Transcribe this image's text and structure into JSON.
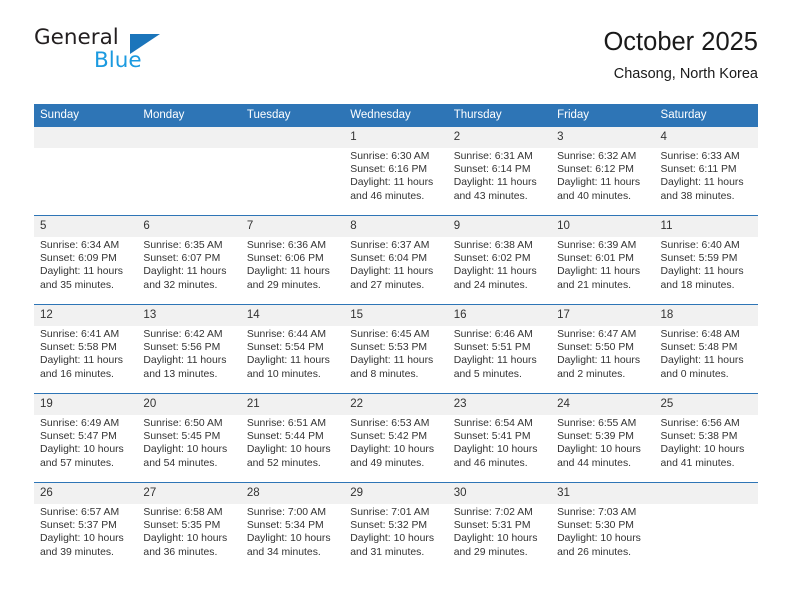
{
  "logo": {
    "word_top": "General",
    "word_bottom": "Blue",
    "triangle_color": "#1b75bb",
    "blue_text_color": "#1b9ae0"
  },
  "header": {
    "title": "October 2025",
    "subtitle": "Chasong, North Korea"
  },
  "theme": {
    "header_row_bg": "#2e75b6",
    "daynum_bg": "#f1f1f1",
    "grid_line": "#2e75b6",
    "text": "#333333"
  },
  "columns": [
    "Sunday",
    "Monday",
    "Tuesday",
    "Wednesday",
    "Thursday",
    "Friday",
    "Saturday"
  ],
  "labels": {
    "sunrise_prefix": "Sunrise:",
    "sunset_prefix": "Sunset:",
    "daylight_prefix": "Daylight:"
  },
  "weeks": [
    [
      {
        "day": "",
        "sunrise": "",
        "sunset": "",
        "daylight": "",
        "empty": true
      },
      {
        "day": "",
        "sunrise": "",
        "sunset": "",
        "daylight": "",
        "empty": true
      },
      {
        "day": "",
        "sunrise": "",
        "sunset": "",
        "daylight": "",
        "empty": true
      },
      {
        "day": "1",
        "sunrise": "Sunrise: 6:30 AM",
        "sunset": "Sunset: 6:16 PM",
        "daylight": "Daylight: 11 hours and 46 minutes."
      },
      {
        "day": "2",
        "sunrise": "Sunrise: 6:31 AM",
        "sunset": "Sunset: 6:14 PM",
        "daylight": "Daylight: 11 hours and 43 minutes."
      },
      {
        "day": "3",
        "sunrise": "Sunrise: 6:32 AM",
        "sunset": "Sunset: 6:12 PM",
        "daylight": "Daylight: 11 hours and 40 minutes."
      },
      {
        "day": "4",
        "sunrise": "Sunrise: 6:33 AM",
        "sunset": "Sunset: 6:11 PM",
        "daylight": "Daylight: 11 hours and 38 minutes."
      }
    ],
    [
      {
        "day": "5",
        "sunrise": "Sunrise: 6:34 AM",
        "sunset": "Sunset: 6:09 PM",
        "daylight": "Daylight: 11 hours and 35 minutes."
      },
      {
        "day": "6",
        "sunrise": "Sunrise: 6:35 AM",
        "sunset": "Sunset: 6:07 PM",
        "daylight": "Daylight: 11 hours and 32 minutes."
      },
      {
        "day": "7",
        "sunrise": "Sunrise: 6:36 AM",
        "sunset": "Sunset: 6:06 PM",
        "daylight": "Daylight: 11 hours and 29 minutes."
      },
      {
        "day": "8",
        "sunrise": "Sunrise: 6:37 AM",
        "sunset": "Sunset: 6:04 PM",
        "daylight": "Daylight: 11 hours and 27 minutes."
      },
      {
        "day": "9",
        "sunrise": "Sunrise: 6:38 AM",
        "sunset": "Sunset: 6:02 PM",
        "daylight": "Daylight: 11 hours and 24 minutes."
      },
      {
        "day": "10",
        "sunrise": "Sunrise: 6:39 AM",
        "sunset": "Sunset: 6:01 PM",
        "daylight": "Daylight: 11 hours and 21 minutes."
      },
      {
        "day": "11",
        "sunrise": "Sunrise: 6:40 AM",
        "sunset": "Sunset: 5:59 PM",
        "daylight": "Daylight: 11 hours and 18 minutes."
      }
    ],
    [
      {
        "day": "12",
        "sunrise": "Sunrise: 6:41 AM",
        "sunset": "Sunset: 5:58 PM",
        "daylight": "Daylight: 11 hours and 16 minutes."
      },
      {
        "day": "13",
        "sunrise": "Sunrise: 6:42 AM",
        "sunset": "Sunset: 5:56 PM",
        "daylight": "Daylight: 11 hours and 13 minutes."
      },
      {
        "day": "14",
        "sunrise": "Sunrise: 6:44 AM",
        "sunset": "Sunset: 5:54 PM",
        "daylight": "Daylight: 11 hours and 10 minutes."
      },
      {
        "day": "15",
        "sunrise": "Sunrise: 6:45 AM",
        "sunset": "Sunset: 5:53 PM",
        "daylight": "Daylight: 11 hours and 8 minutes."
      },
      {
        "day": "16",
        "sunrise": "Sunrise: 6:46 AM",
        "sunset": "Sunset: 5:51 PM",
        "daylight": "Daylight: 11 hours and 5 minutes."
      },
      {
        "day": "17",
        "sunrise": "Sunrise: 6:47 AM",
        "sunset": "Sunset: 5:50 PM",
        "daylight": "Daylight: 11 hours and 2 minutes."
      },
      {
        "day": "18",
        "sunrise": "Sunrise: 6:48 AM",
        "sunset": "Sunset: 5:48 PM",
        "daylight": "Daylight: 11 hours and 0 minutes."
      }
    ],
    [
      {
        "day": "19",
        "sunrise": "Sunrise: 6:49 AM",
        "sunset": "Sunset: 5:47 PM",
        "daylight": "Daylight: 10 hours and 57 minutes."
      },
      {
        "day": "20",
        "sunrise": "Sunrise: 6:50 AM",
        "sunset": "Sunset: 5:45 PM",
        "daylight": "Daylight: 10 hours and 54 minutes."
      },
      {
        "day": "21",
        "sunrise": "Sunrise: 6:51 AM",
        "sunset": "Sunset: 5:44 PM",
        "daylight": "Daylight: 10 hours and 52 minutes."
      },
      {
        "day": "22",
        "sunrise": "Sunrise: 6:53 AM",
        "sunset": "Sunset: 5:42 PM",
        "daylight": "Daylight: 10 hours and 49 minutes."
      },
      {
        "day": "23",
        "sunrise": "Sunrise: 6:54 AM",
        "sunset": "Sunset: 5:41 PM",
        "daylight": "Daylight: 10 hours and 46 minutes."
      },
      {
        "day": "24",
        "sunrise": "Sunrise: 6:55 AM",
        "sunset": "Sunset: 5:39 PM",
        "daylight": "Daylight: 10 hours and 44 minutes."
      },
      {
        "day": "25",
        "sunrise": "Sunrise: 6:56 AM",
        "sunset": "Sunset: 5:38 PM",
        "daylight": "Daylight: 10 hours and 41 minutes."
      }
    ],
    [
      {
        "day": "26",
        "sunrise": "Sunrise: 6:57 AM",
        "sunset": "Sunset: 5:37 PM",
        "daylight": "Daylight: 10 hours and 39 minutes."
      },
      {
        "day": "27",
        "sunrise": "Sunrise: 6:58 AM",
        "sunset": "Sunset: 5:35 PM",
        "daylight": "Daylight: 10 hours and 36 minutes."
      },
      {
        "day": "28",
        "sunrise": "Sunrise: 7:00 AM",
        "sunset": "Sunset: 5:34 PM",
        "daylight": "Daylight: 10 hours and 34 minutes."
      },
      {
        "day": "29",
        "sunrise": "Sunrise: 7:01 AM",
        "sunset": "Sunset: 5:32 PM",
        "daylight": "Daylight: 10 hours and 31 minutes."
      },
      {
        "day": "30",
        "sunrise": "Sunrise: 7:02 AM",
        "sunset": "Sunset: 5:31 PM",
        "daylight": "Daylight: 10 hours and 29 minutes."
      },
      {
        "day": "31",
        "sunrise": "Sunrise: 7:03 AM",
        "sunset": "Sunset: 5:30 PM",
        "daylight": "Daylight: 10 hours and 26 minutes."
      },
      {
        "day": "",
        "sunrise": "",
        "sunset": "",
        "daylight": "",
        "empty": true
      }
    ]
  ]
}
